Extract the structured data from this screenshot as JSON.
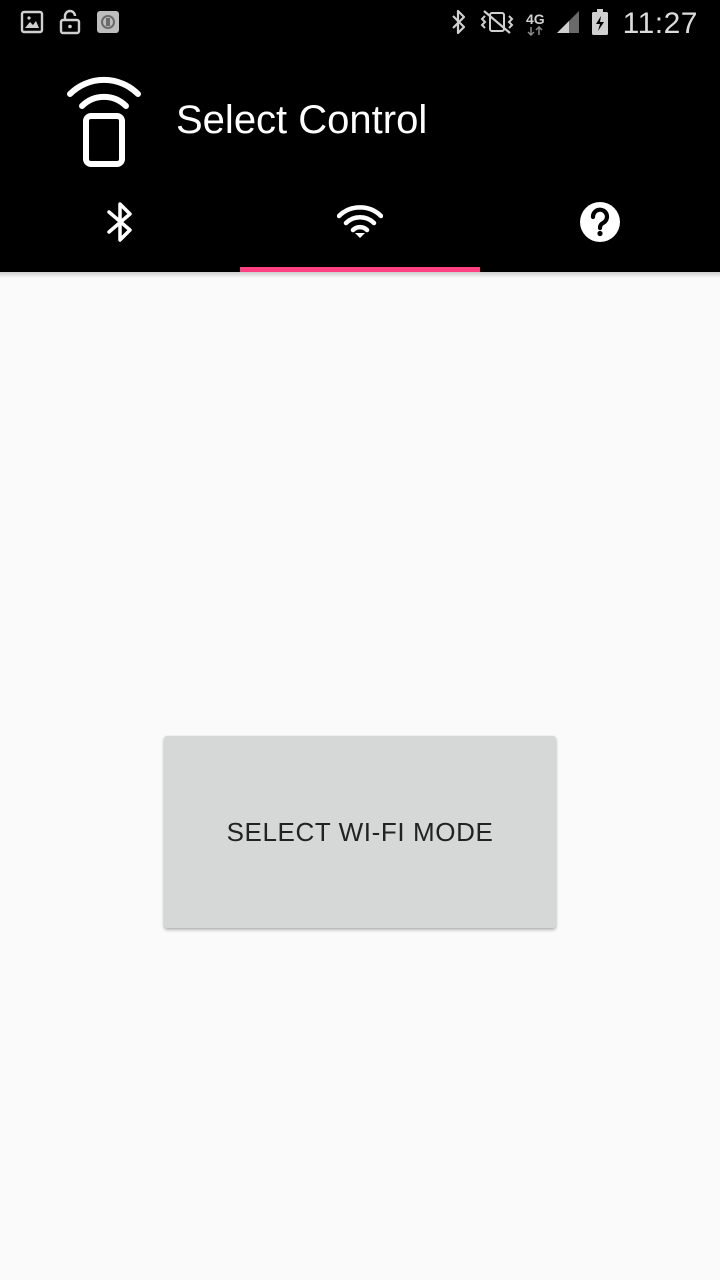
{
  "status_bar": {
    "time": "11:27",
    "network_type": "4G",
    "left_icons": [
      "gallery-icon",
      "lock-icon",
      "app-notification-icon"
    ],
    "right_icons": [
      "bluetooth-icon",
      "vibrate-mute-icon",
      "network-4g-icon",
      "signal-icon",
      "battery-charging-icon"
    ]
  },
  "app_bar": {
    "title": "Select Control",
    "logo_icon": "remote-phone-wifi-icon"
  },
  "tabs": [
    {
      "icon": "bluetooth-icon",
      "selected": false
    },
    {
      "icon": "wifi-icon",
      "selected": true
    },
    {
      "icon": "help-icon",
      "selected": false
    }
  ],
  "main": {
    "button_label": "SELECT WI-FI MODE"
  },
  "colors": {
    "app_bar_bg": "#000000",
    "tab_indicator": "#ff4081",
    "content_bg": "#fafafa",
    "button_bg": "#d6d7d7",
    "button_text": "#222222"
  }
}
